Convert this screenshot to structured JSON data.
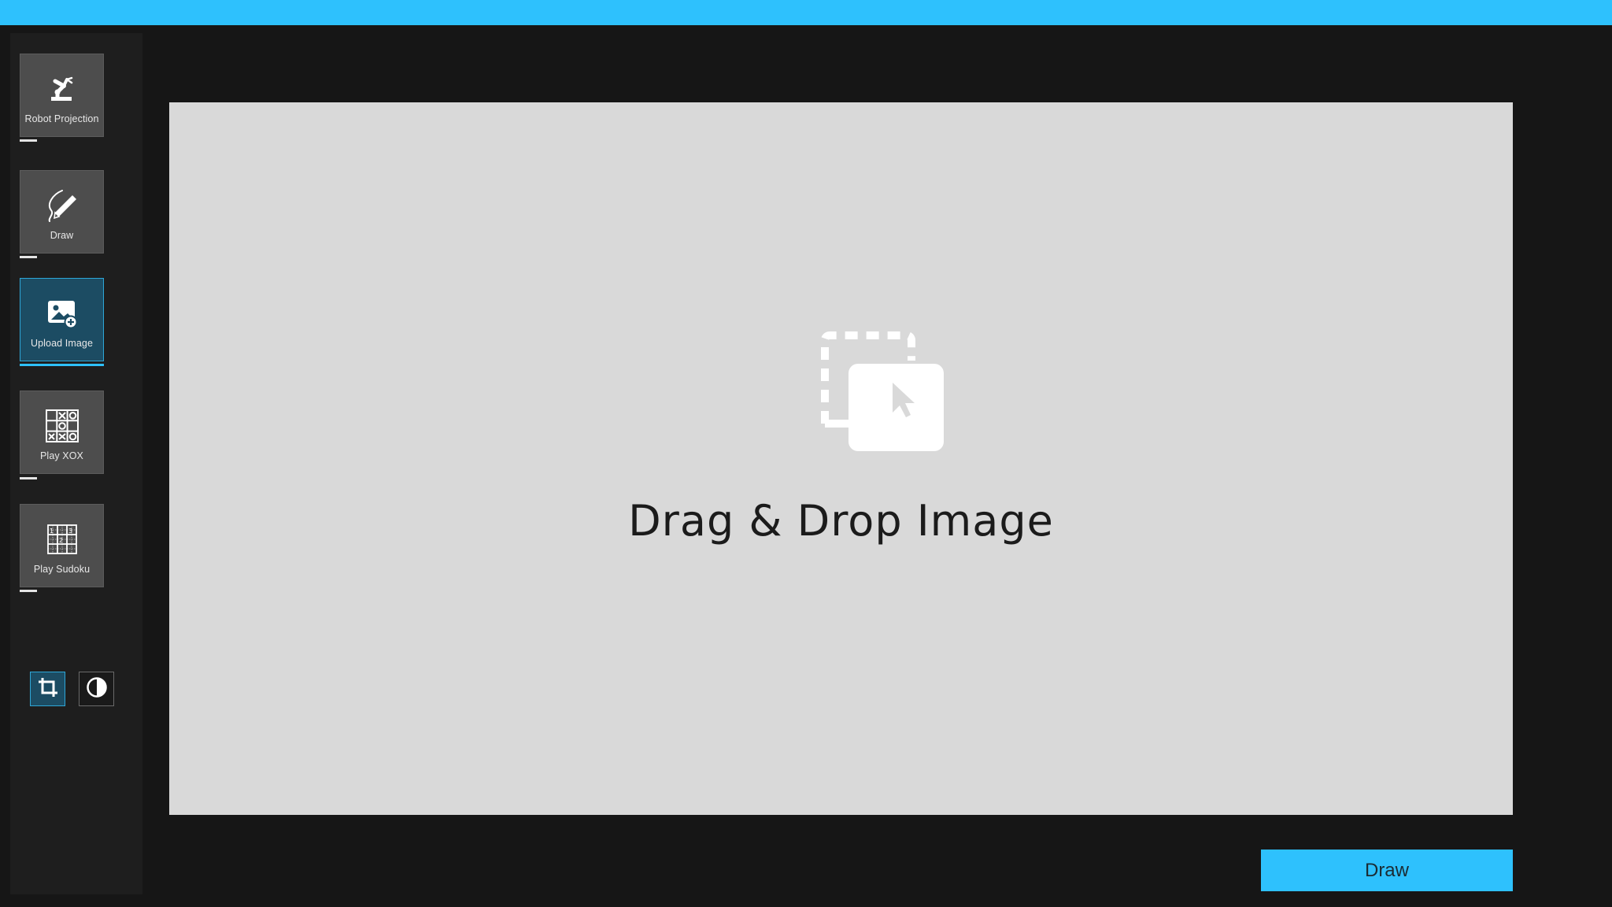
{
  "colors": {
    "accent": "#2ec1fd",
    "active_tile": "#1c4c63",
    "tile": "#4d4d4d",
    "background": "#161616",
    "dropzone": "#d9d9d9"
  },
  "sidebar": {
    "modes": [
      {
        "label": "Robot Projection",
        "icon": "robot-arm-icon",
        "active": false
      },
      {
        "label": "Draw",
        "icon": "pencil-scribble-icon",
        "active": false
      },
      {
        "label": "Upload Image",
        "icon": "image-add-icon",
        "active": true
      },
      {
        "label": "Play XOX",
        "icon": "tic-tac-toe-icon",
        "active": false
      },
      {
        "label": "Play Sudoku",
        "icon": "sudoku-grid-icon",
        "active": false
      }
    ],
    "tools": [
      {
        "icon": "crop-icon",
        "active": true
      },
      {
        "icon": "contrast-icon",
        "active": false
      }
    ]
  },
  "dropzone": {
    "icon": "drag-drop-icon",
    "text": "Drag & Drop Image"
  },
  "actions": {
    "draw_label": "Draw"
  }
}
